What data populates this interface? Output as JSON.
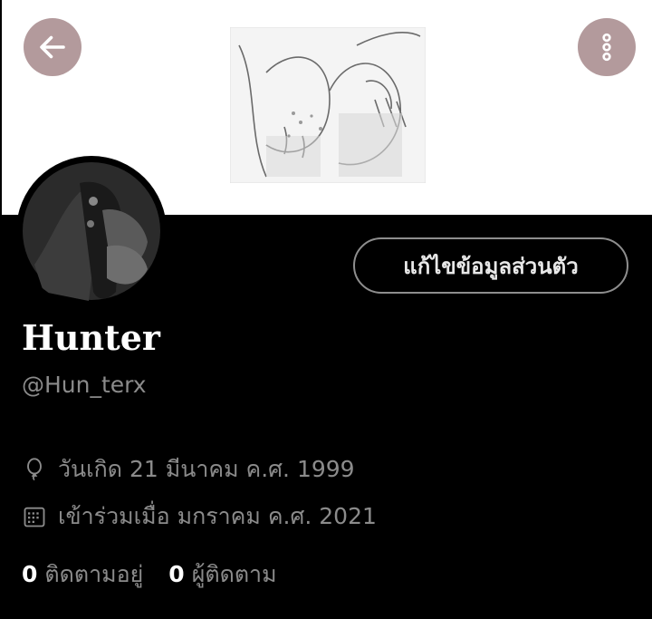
{
  "profile": {
    "display_name": "Hunter",
    "handle": "@Hun_terx",
    "edit_button_label": "แก้ไขข้อมูลส่วนตัว",
    "birthday": "วันเกิด 21 มีนาคม ค.ศ. 1999",
    "joined": "เข้าร่วมเมื่อ มกราคม ค.ศ. 2021"
  },
  "stats": {
    "following_count": "0",
    "following_label": "ติดตามอยู่",
    "followers_count": "0",
    "followers_label": "ผู้ติดตาม"
  },
  "icons": {
    "back": "arrow-left-icon",
    "more": "more-vertical-icon",
    "birthday": "balloon-icon",
    "joined": "calendar-icon"
  },
  "colors": {
    "background": "#000000",
    "banner": "#ffffff",
    "header_button": "#b39a9c",
    "muted_text": "#8b8b8b",
    "edit_border": "#8e8e8e"
  }
}
